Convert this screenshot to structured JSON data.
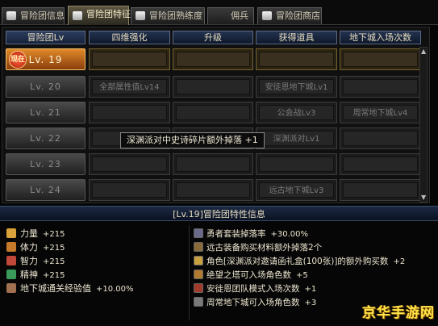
{
  "tabs": [
    {
      "label": "冒险团信息",
      "active": false
    },
    {
      "label": "冒险团特征",
      "active": true
    },
    {
      "label": "冒险团熟练度",
      "active": false
    },
    {
      "label": "佣兵",
      "active": false
    },
    {
      "label": "冒险团商店",
      "active": false
    }
  ],
  "grid": {
    "headers": [
      "冒险团Lv",
      "四维强化",
      "升级",
      "获得道具",
      "地下城入场次数"
    ],
    "current_badge": "现在",
    "rows": [
      {
        "level": "Lv. 19",
        "current": true,
        "cells": [
          "",
          "",
          "",
          ""
        ]
      },
      {
        "level": "Lv. 20",
        "current": false,
        "cells": [
          "全部属性值Lv14",
          "",
          "安徒恩地下城Lv1",
          ""
        ]
      },
      {
        "level": "Lv. 21",
        "current": false,
        "cells": [
          "",
          "",
          "公会战Lv3",
          "周常地下城Lv4"
        ]
      },
      {
        "level": "Lv. 22",
        "current": false,
        "cells": [
          "",
          "",
          "深渊派对Lv1",
          ""
        ]
      },
      {
        "level": "Lv. 23",
        "current": false,
        "cells": [
          "",
          "",
          "",
          ""
        ]
      },
      {
        "level": "Lv. 24",
        "current": false,
        "cells": [
          "",
          "",
          "远古地下城Lv3",
          ""
        ]
      }
    ]
  },
  "tooltip": "深渊派对中史诗碎片额外掉落 +1",
  "info": {
    "title": "[Lv.19]冒险团特性信息",
    "stats": [
      {
        "icon": "strength-icon",
        "label": "力量",
        "value": "+215",
        "color": "#d9a23a"
      },
      {
        "icon": "stamina-icon",
        "label": "体力",
        "value": "+215",
        "color": "#c47a2a"
      },
      {
        "icon": "intelligence-icon",
        "label": "智力",
        "value": "+215",
        "color": "#c0483a"
      },
      {
        "icon": "spirit-icon",
        "label": "精神",
        "value": "+215",
        "color": "#3a9a5a"
      },
      {
        "icon": "dungeon-exp-icon",
        "label": "地下城通关经验值",
        "value": "+10.00%",
        "color": "#a07050"
      }
    ],
    "features": [
      {
        "icon": "equipment-drop-icon",
        "label": "勇者套装掉落率",
        "value": "+30.00%",
        "color": "#6a6a8a"
      },
      {
        "icon": "material-purchase-icon",
        "label": "远古装备购买材料额外掉落2个",
        "value": "",
        "color": "#8a6a3a"
      },
      {
        "icon": "invitation-box-icon",
        "label": "角色[深渊派对邀请函礼盒(100张)]的额外购买数",
        "value": "+2",
        "color": "#c9a040"
      },
      {
        "icon": "tower-entry-icon",
        "label": "绝望之塔可入场角色数",
        "value": "+5",
        "color": "#b07a30"
      },
      {
        "icon": "anton-raid-icon",
        "label": "安徒恩团队模式入场次数",
        "value": "+1",
        "color": "#a03a2a"
      },
      {
        "icon": "weekly-dungeon-icon",
        "label": "周常地下城可入场角色数",
        "value": "+3",
        "color": "#7a7a7a"
      }
    ]
  },
  "watermark": "京华手游网"
}
